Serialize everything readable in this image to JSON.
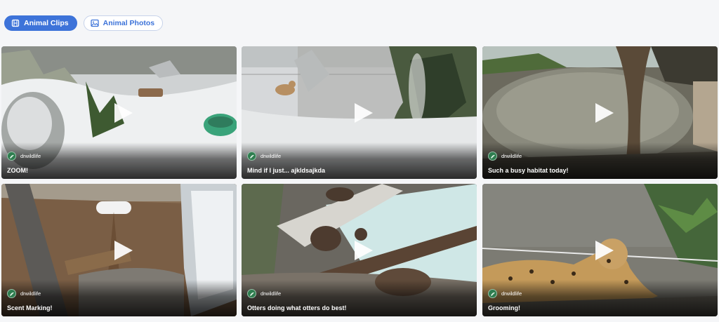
{
  "tabs": [
    {
      "label": "Animal Clips",
      "icon": "film-icon",
      "active": true
    },
    {
      "label": "Animal Photos",
      "icon": "image-icon",
      "active": false
    }
  ],
  "colors": {
    "accent": "#3d73d9",
    "background": "#f5f6f8",
    "avatar": "#2e7d4f"
  },
  "clips": [
    {
      "author": "drwildlife",
      "title": "ZOOM!"
    },
    {
      "author": "drwildlife",
      "title": "Mind if I just... ajkldsajkda"
    },
    {
      "author": "drwildlife",
      "title": "Such a busy habitat today!"
    },
    {
      "author": "drwildlife",
      "title": "Scent Marking!"
    },
    {
      "author": "drwildlife",
      "title": "Otters doing what otters do best!"
    },
    {
      "author": "drwildlife",
      "title": "Grooming!"
    }
  ]
}
